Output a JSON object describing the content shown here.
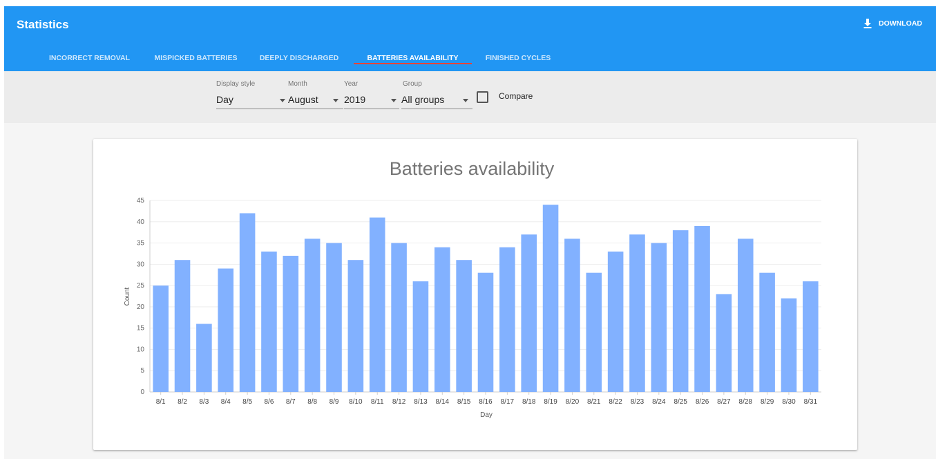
{
  "header": {
    "title": "Statistics",
    "download_label": "DOWNLOAD",
    "download_icon": "download-icon",
    "color": "#2196f3"
  },
  "tabs": [
    {
      "label": "INCORRECT REMOVAL",
      "active": false
    },
    {
      "label": "MISPICKED BATTERIES",
      "active": false
    },
    {
      "label": "DEEPLY DISCHARGED",
      "active": false
    },
    {
      "label": "BATTERIES AVAILABILITY",
      "active": true
    },
    {
      "label": "FINISHED CYCLES",
      "active": false
    }
  ],
  "filters": {
    "display_style": {
      "label": "Display style",
      "value": "Day"
    },
    "month": {
      "label": "Month",
      "value": "August"
    },
    "year": {
      "label": "Year",
      "value": "2019"
    },
    "group": {
      "label": "Group",
      "value": "All groups"
    },
    "compare": {
      "label": "Compare",
      "checked": false
    }
  },
  "colors": {
    "bar": "#82b1ff",
    "accent_indicator": "#f44336"
  },
  "chart_data": {
    "type": "bar",
    "title": "Batteries availability",
    "xlabel": "Day",
    "ylabel": "Count",
    "ylim": [
      0,
      45
    ],
    "yticks": [
      0,
      5,
      10,
      15,
      20,
      25,
      30,
      35,
      40,
      45
    ],
    "grid": true,
    "categories": [
      "8/1",
      "8/2",
      "8/3",
      "8/4",
      "8/5",
      "8/6",
      "8/7",
      "8/8",
      "8/9",
      "8/10",
      "8/11",
      "8/12",
      "8/13",
      "8/14",
      "8/15",
      "8/16",
      "8/17",
      "8/18",
      "8/19",
      "8/20",
      "8/21",
      "8/22",
      "8/23",
      "8/24",
      "8/25",
      "8/26",
      "8/27",
      "8/28",
      "8/29",
      "8/30",
      "8/31"
    ],
    "values": [
      25,
      31,
      16,
      29,
      42,
      33,
      32,
      36,
      35,
      31,
      41,
      35,
      26,
      34,
      31,
      28,
      34,
      37,
      44,
      36,
      28,
      33,
      37,
      35,
      38,
      39,
      23,
      36,
      28,
      22,
      26
    ]
  }
}
